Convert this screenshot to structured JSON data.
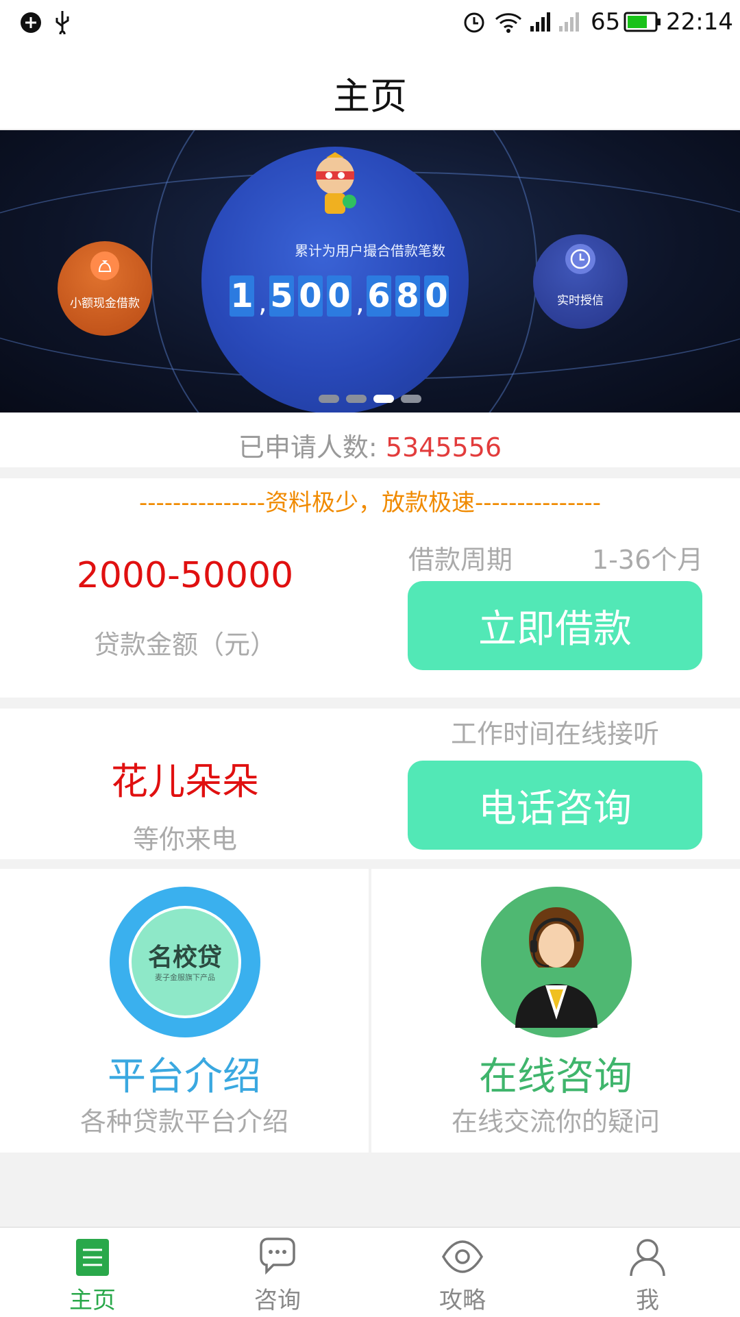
{
  "status_bar": {
    "battery_level": "65",
    "time": "22:14"
  },
  "header": {
    "title": "主页"
  },
  "banner": {
    "caption": "累计为用户撮合借款笔数",
    "counter_digits": [
      "1",
      ",",
      "5",
      "0",
      "0",
      ",",
      "6",
      "8",
      "0"
    ],
    "left_bubble_label": "小额现金借款",
    "right_bubble_label": "实时授信",
    "active_slide": 3,
    "slide_count": 4
  },
  "stats": {
    "label": "已申请人数:",
    "value": "5345556"
  },
  "loan": {
    "tagline": "---------------资料极少，放款极速---------------",
    "amount_range": "2000-50000",
    "amount_label": "贷款金额（元）",
    "period_label": "借款周期",
    "period_value": "1-36个月",
    "cta_label": "立即借款"
  },
  "consult": {
    "name": "花儿朵朵",
    "subtitle": "等你来电",
    "hint": "工作时间在线接听",
    "cta_label": "电话咨询"
  },
  "tiles": [
    {
      "logo_text": "名校贷",
      "logo_subtext": "麦子金服旗下产品",
      "title": "平台介绍",
      "subtitle": "各种贷款平台介绍",
      "title_color": "#3aa8e0"
    },
    {
      "title": "在线咨询",
      "subtitle": "在线交流你的疑问",
      "title_color": "#3fb56c"
    }
  ],
  "nav": {
    "items": [
      {
        "label": "主页",
        "icon": "home-list-icon",
        "active": true
      },
      {
        "label": "咨询",
        "icon": "chat-bubble-icon",
        "active": false
      },
      {
        "label": "攻略",
        "icon": "eye-icon",
        "active": false
      },
      {
        "label": "我",
        "icon": "person-icon",
        "active": false
      }
    ]
  },
  "colors": {
    "accent_green": "#52e8b6",
    "nav_active": "#29a84a",
    "stat_red": "#e23c3c",
    "tagline_orange": "#f08a00"
  }
}
